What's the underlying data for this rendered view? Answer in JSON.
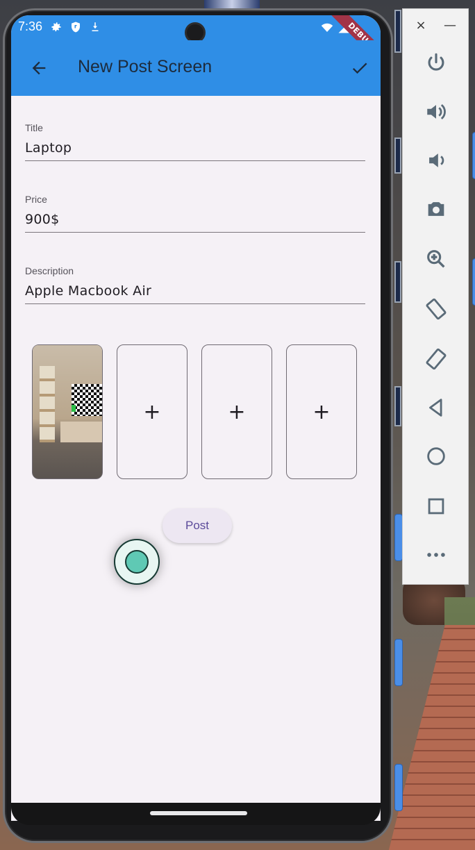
{
  "status_bar": {
    "time": "7:36",
    "debug_banner": "DEBUG"
  },
  "app_bar": {
    "title": "New Post Screen"
  },
  "form": {
    "fields": [
      {
        "label": "Title",
        "value": "Laptop"
      },
      {
        "label": "Price",
        "value": "900$"
      },
      {
        "label": "Description",
        "value": "Apple Macbook Air"
      }
    ],
    "add_image_symbol": "+",
    "post_label": "Post"
  },
  "emulator_panel": {
    "close_symbol": "×",
    "minimize_symbol": "—",
    "buttons": [
      "power",
      "volume-up",
      "volume-down",
      "camera",
      "zoom",
      "rotate-left",
      "rotate-right",
      "back",
      "home",
      "overview",
      "more"
    ]
  },
  "colors": {
    "app_bar": "#2f8ee6",
    "screen_bg": "#f5f1f6",
    "post_text": "#5b4a9a"
  }
}
